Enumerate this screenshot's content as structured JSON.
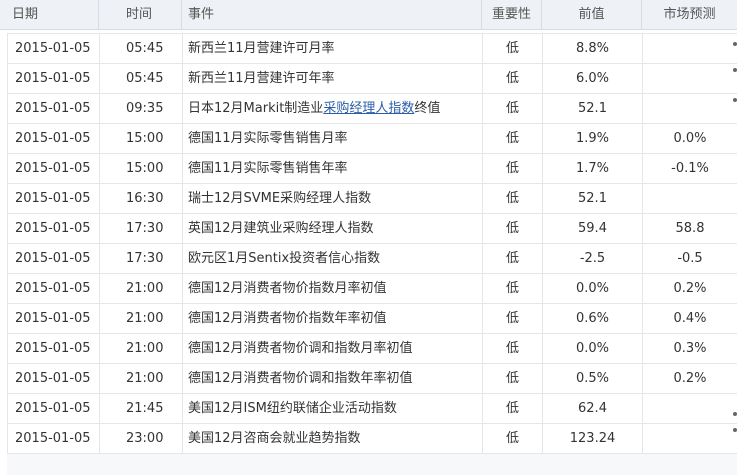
{
  "headers": {
    "date": "日期",
    "time": "时间",
    "event": "事件",
    "importance": "重要性",
    "previous": "前值",
    "forecast": "市场预测"
  },
  "rows": [
    {
      "date": "2015-01-05",
      "time": "05:45",
      "event_pre": "新西兰11月营建许可月率",
      "event_link": "",
      "event_post": "",
      "importance": "低",
      "previous": "8.8%",
      "forecast": ""
    },
    {
      "date": "2015-01-05",
      "time": "05:45",
      "event_pre": "新西兰11月营建许可年率",
      "event_link": "",
      "event_post": "",
      "importance": "低",
      "previous": "6.0%",
      "forecast": ""
    },
    {
      "date": "2015-01-05",
      "time": "09:35",
      "event_pre": "日本12月Markit制造业",
      "event_link": "采购经理人指数",
      "event_post": "终值",
      "importance": "低",
      "previous": "52.1",
      "forecast": ""
    },
    {
      "date": "2015-01-05",
      "time": "15:00",
      "event_pre": "德国11月实际零售销售月率",
      "event_link": "",
      "event_post": "",
      "importance": "低",
      "previous": "1.9%",
      "forecast": "0.0%"
    },
    {
      "date": "2015-01-05",
      "time": "15:00",
      "event_pre": "德国11月实际零售销售年率",
      "event_link": "",
      "event_post": "",
      "importance": "低",
      "previous": "1.7%",
      "forecast": "-0.1%"
    },
    {
      "date": "2015-01-05",
      "time": "16:30",
      "event_pre": "瑞士12月SVME采购经理人指数",
      "event_link": "",
      "event_post": "",
      "importance": "低",
      "previous": "52.1",
      "forecast": ""
    },
    {
      "date": "2015-01-05",
      "time": "17:30",
      "event_pre": "英国12月建筑业采购经理人指数",
      "event_link": "",
      "event_post": "",
      "importance": "低",
      "previous": "59.4",
      "forecast": "58.8"
    },
    {
      "date": "2015-01-05",
      "time": "17:30",
      "event_pre": "欧元区1月Sentix投资者信心指数",
      "event_link": "",
      "event_post": "",
      "importance": "低",
      "previous": "-2.5",
      "forecast": "-0.5"
    },
    {
      "date": "2015-01-05",
      "time": "21:00",
      "event_pre": "德国12月消费者物价指数月率初值",
      "event_link": "",
      "event_post": "",
      "importance": "低",
      "previous": "0.0%",
      "forecast": "0.2%"
    },
    {
      "date": "2015-01-05",
      "time": "21:00",
      "event_pre": "德国12月消费者物价指数年率初值",
      "event_link": "",
      "event_post": "",
      "importance": "低",
      "previous": "0.6%",
      "forecast": "0.4%"
    },
    {
      "date": "2015-01-05",
      "time": "21:00",
      "event_pre": "德国12月消费者物价调和指数月率初值",
      "event_link": "",
      "event_post": "",
      "importance": "低",
      "previous": "0.0%",
      "forecast": "0.3%"
    },
    {
      "date": "2015-01-05",
      "time": "21:00",
      "event_pre": "德国12月消费者物价调和指数年率初值",
      "event_link": "",
      "event_post": "",
      "importance": "低",
      "previous": "0.5%",
      "forecast": "0.2%"
    },
    {
      "date": "2015-01-05",
      "time": "21:45",
      "event_pre": "美国12月ISM纽约联储企业活动指数",
      "event_link": "",
      "event_post": "",
      "importance": "低",
      "previous": "62.4",
      "forecast": ""
    },
    {
      "date": "2015-01-05",
      "time": "23:00",
      "event_pre": "美国12月咨商会就业趋势指数",
      "event_link": "",
      "event_post": "",
      "importance": "低",
      "previous": "123.24",
      "forecast": ""
    }
  ]
}
